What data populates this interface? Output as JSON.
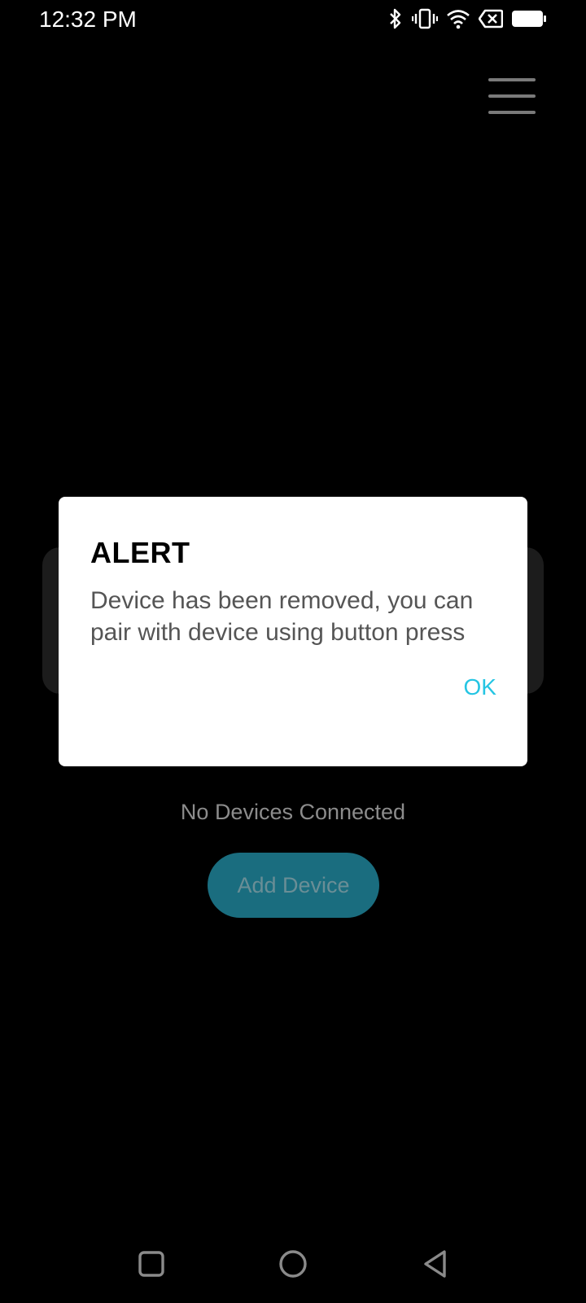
{
  "status_bar": {
    "time": "12:32 PM",
    "icons": [
      "bluetooth-icon",
      "vibrate-icon",
      "wifi-icon",
      "no-sim-icon",
      "battery-icon"
    ]
  },
  "header": {
    "menu_icon": "hamburger-menu-icon"
  },
  "main": {
    "empty_state_text": "No Devices Connected",
    "add_device_label": "Add Device"
  },
  "dialog": {
    "title": "ALERT",
    "message": "Device has been removed, you can pair with device using button press",
    "ok_label": "OK"
  },
  "navigation": {
    "buttons": [
      "recents-icon",
      "home-icon",
      "back-icon"
    ]
  },
  "colors": {
    "background": "#000000",
    "accent": "#25c5e3",
    "add_button": "#1a6d7f",
    "dialog_bg": "#ffffff"
  }
}
